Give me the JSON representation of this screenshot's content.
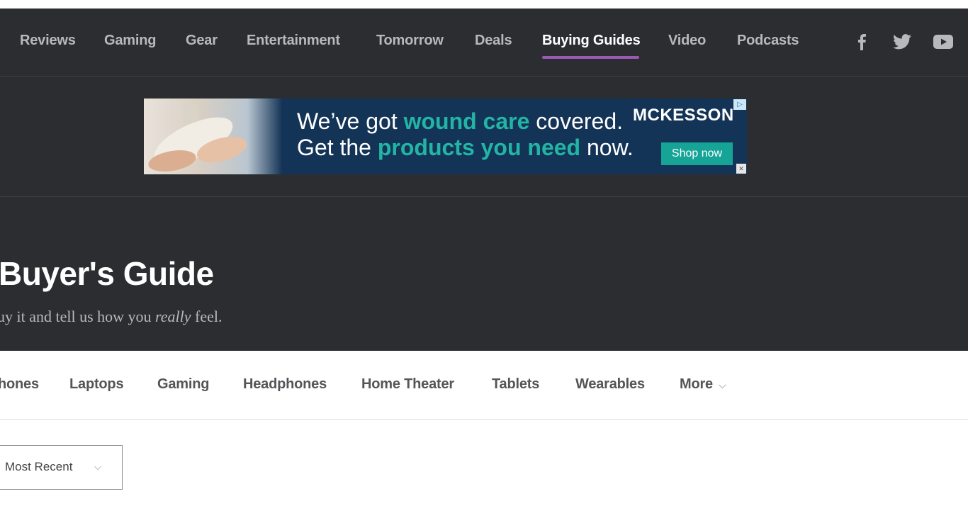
{
  "nav": {
    "items": [
      {
        "label": "Reviews",
        "active": false
      },
      {
        "label": "Gaming",
        "active": false
      },
      {
        "label": "Gear",
        "active": false
      },
      {
        "label": "Entertainment",
        "active": false
      },
      {
        "label": "Tomorrow",
        "active": false
      },
      {
        "label": "Deals",
        "active": false
      },
      {
        "label": "Buying Guides",
        "active": true
      },
      {
        "label": "Video",
        "active": false
      },
      {
        "label": "Podcasts",
        "active": false
      }
    ],
    "social": [
      "facebook-icon",
      "twitter-icon",
      "youtube-icon"
    ],
    "accent_color": "#9b59b6"
  },
  "ad": {
    "line1_prefix": "We’ve got ",
    "line1_highlight": "wound care",
    "line1_suffix": " covered.",
    "line2_prefix": "Get the ",
    "line2_highlight": "products you need",
    "line2_suffix": " now.",
    "brand": "MCKESSON",
    "cta": "Shop now",
    "highlight_color": "#22b5a5"
  },
  "page": {
    "title": "Buyer's Guide",
    "subtitle_prefix": "uy it and tell us how you ",
    "subtitle_emphasis": "really",
    "subtitle_suffix": " feel."
  },
  "categories": {
    "items": [
      "hones",
      "Laptops",
      "Gaming",
      "Headphones",
      "Home Theater",
      "Tablets",
      "Wearables"
    ],
    "more_label": "More"
  },
  "sort": {
    "selected": "Most Recent"
  }
}
